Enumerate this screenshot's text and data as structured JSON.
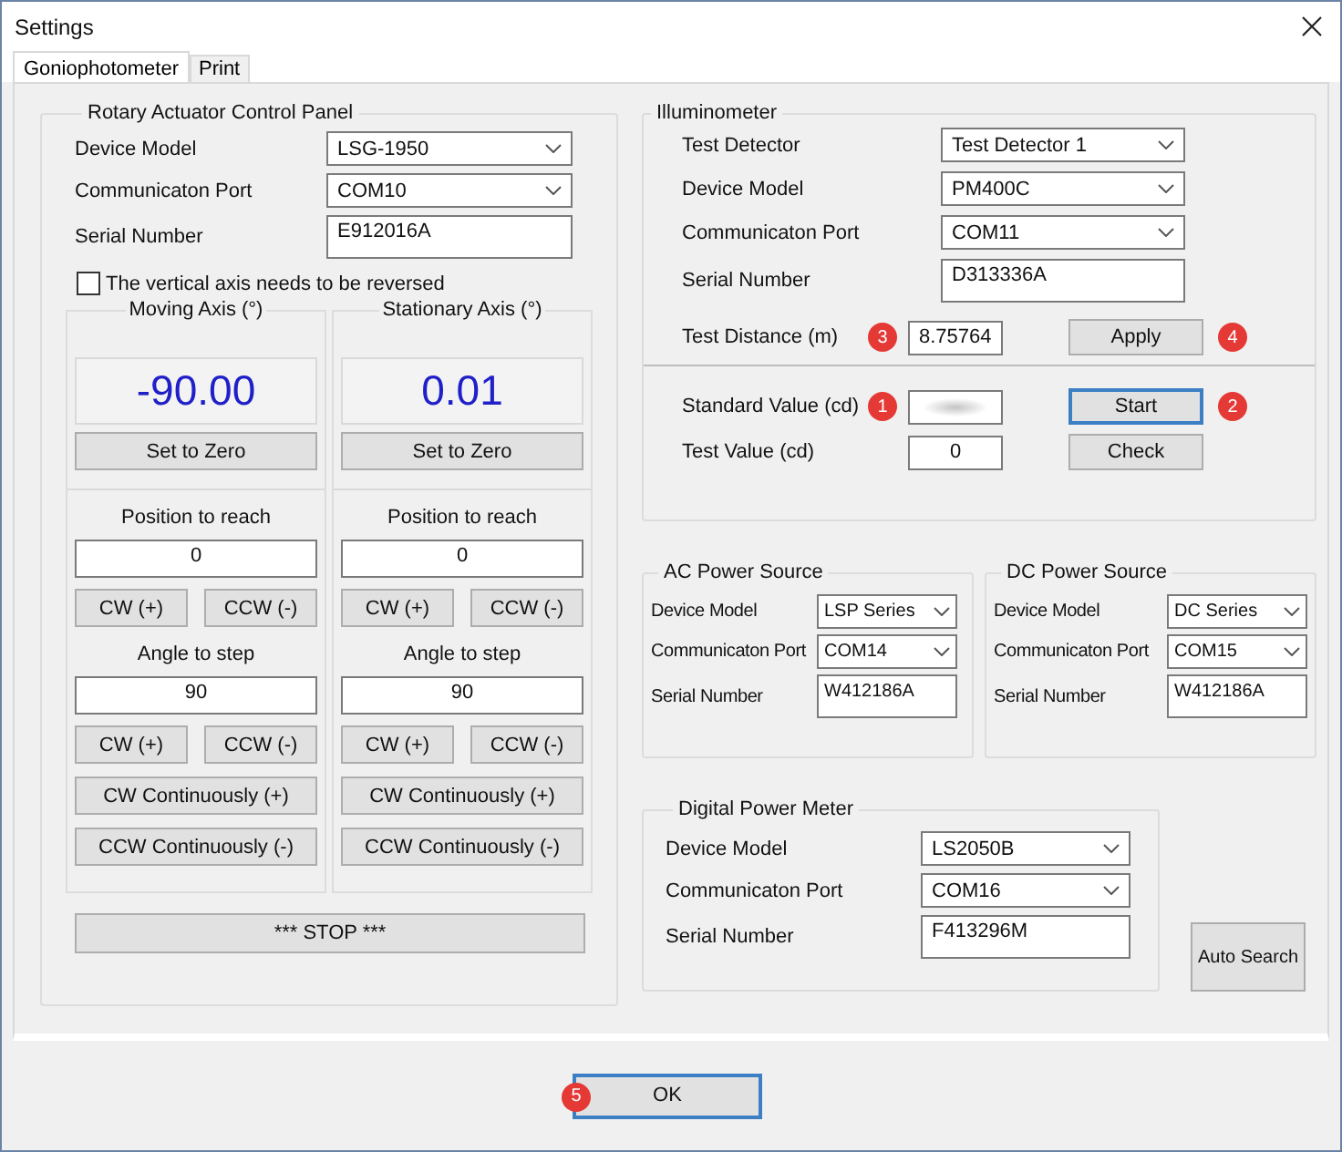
{
  "window": {
    "title": "Settings"
  },
  "tabs": [
    {
      "label": "Goniophotometer",
      "selected": true
    },
    {
      "label": "Print",
      "selected": false
    }
  ],
  "rotary": {
    "title": "Rotary Actuator Control Panel",
    "fields": [
      {
        "kind": "dropdown",
        "label": "Device Model",
        "value": "LSG-1950"
      },
      {
        "kind": "dropdown",
        "label": "Communicaton Port",
        "value": "COM10"
      },
      {
        "kind": "text",
        "label": "Serial Number",
        "value": "E912016A"
      }
    ],
    "reverse": {
      "label": "The vertical axis needs to be reversed",
      "checked": false
    },
    "axes": [
      {
        "title": "Moving Axis (°)",
        "reading": "-90.00",
        "zero_button": "Set to Zero",
        "position_label": "Position to reach",
        "position_value": "0",
        "position_buttons": [
          "CW  (+)",
          "CCW (-)"
        ],
        "step_label": "Angle to step",
        "step_value": "90",
        "step_buttons": [
          "CW  (+)",
          "CCW (-)"
        ],
        "continuous_buttons": [
          "CW Continuously (+)",
          "CCW Continuously (-)"
        ]
      },
      {
        "title": "Stationary Axis (°)",
        "reading": "0.01",
        "zero_button": "Set to Zero",
        "position_label": "Position to reach",
        "position_value": "0",
        "position_buttons": [
          "CW  (+)",
          "CCW (-)"
        ],
        "step_label": "Angle to step",
        "step_value": "90",
        "step_buttons": [
          "CW  (+)",
          "CCW (-)"
        ],
        "continuous_buttons": [
          "CW Continuously (+)",
          "CCW Continuously (-)"
        ]
      }
    ],
    "stop_button": "*** STOP ***"
  },
  "illuminometer": {
    "title": "Illuminometer",
    "fields": [
      {
        "kind": "dropdown",
        "label": "Test Detector",
        "value": "Test Detector 1"
      },
      {
        "kind": "dropdown",
        "label": "Device Model",
        "value": "PM400C"
      },
      {
        "kind": "dropdown",
        "label": "Communicaton Port",
        "value": "COM11"
      },
      {
        "kind": "text",
        "label": "Serial Number",
        "value": "D313336A"
      }
    ],
    "distance": {
      "label": "Test Distance (m)",
      "value": "8.75764",
      "badge": "3"
    },
    "apply": {
      "label": "Apply",
      "badge": "4",
      "focused": false
    },
    "standard": {
      "label": "Standard Value (cd)",
      "badge": "1"
    },
    "start": {
      "label": "Start",
      "badge": "2",
      "focused": true
    },
    "test": {
      "label": "Test Value (cd)",
      "value": "0"
    },
    "check": {
      "label": "Check",
      "focused": false
    }
  },
  "ac_power": {
    "title": "AC Power Source",
    "fields": [
      {
        "kind": "dropdown",
        "label": "Device Model",
        "value": "LSP Series"
      },
      {
        "kind": "dropdown",
        "label": "Communicaton Port",
        "value": "COM14"
      },
      {
        "kind": "text",
        "label": "Serial Number",
        "value": "W412186A"
      }
    ]
  },
  "dc_power": {
    "title": "DC Power Source",
    "fields": [
      {
        "kind": "dropdown",
        "label": "Device Model",
        "value": "DC Series"
      },
      {
        "kind": "dropdown",
        "label": "Communicaton Port",
        "value": "COM15"
      },
      {
        "kind": "text",
        "label": "Serial Number",
        "value": "W412186A"
      }
    ]
  },
  "power_meter": {
    "title": "Digital Power Meter",
    "fields": [
      {
        "kind": "dropdown",
        "label": "Device Model",
        "value": "LS2050B"
      },
      {
        "kind": "dropdown",
        "label": "Communicaton Port",
        "value": "COM16"
      },
      {
        "kind": "text",
        "label": "Serial Number",
        "value": "F413296M"
      }
    ]
  },
  "auto_search": {
    "label": "Auto Search"
  },
  "ok": {
    "label": "OK",
    "badge": "5",
    "focused": true
  }
}
